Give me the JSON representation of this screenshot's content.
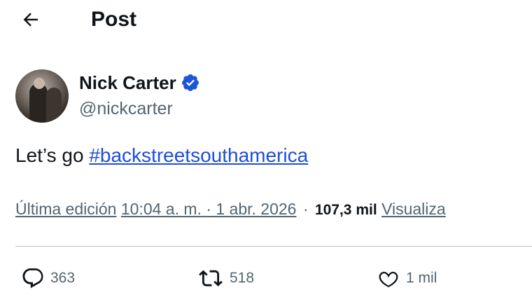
{
  "header": {
    "title": "Post",
    "back_icon": "arrow-left-icon"
  },
  "author": {
    "display_name": "Nick Carter",
    "handle": "@nickcarter",
    "verified_icon": "verified-badge-icon",
    "verified_color": "#1d9bf0"
  },
  "post": {
    "text_prefix": "Let’s go ",
    "hashtag": "#backstreetsouthamerica"
  },
  "meta": {
    "edited_label": "Última edición",
    "time": "10:04 a. m.",
    "dot": "·",
    "date": "1 abr. 2026",
    "views_count": "107,3 mil",
    "views_label": "Visualiza"
  },
  "actions": {
    "reply": {
      "icon": "reply-icon",
      "count": "363"
    },
    "repost": {
      "icon": "repost-icon",
      "count": "518"
    },
    "like": {
      "icon": "heart-icon",
      "count": "1 mil"
    }
  }
}
